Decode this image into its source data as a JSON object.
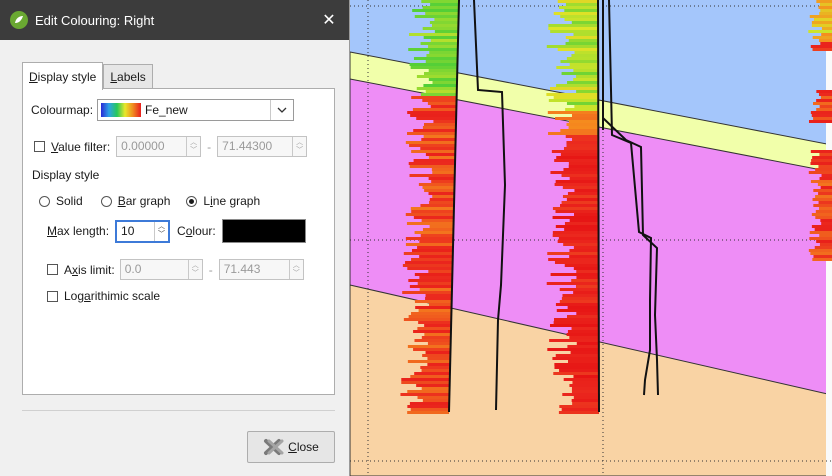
{
  "dialog": {
    "title": "Edit Colouring: Right",
    "close_glyph": "✕",
    "tabs": [
      {
        "label_pre": "",
        "label_key": "D",
        "label_post": "isplay style",
        "active": true
      },
      {
        "label_pre": "",
        "label_key": "L",
        "label_post": "abels",
        "active": false
      }
    ],
    "colourmap": {
      "label": "Colourmap:",
      "selected": "Fe_new",
      "gradient_colors": [
        "#2b2bd6",
        "#2fa3e6",
        "#28c85a",
        "#e8e82c",
        "#f08a20",
        "#e81f1f"
      ]
    },
    "value_filter": {
      "label_key": "V",
      "label_rest": "alue filter:",
      "checked": false,
      "min": "0.00000",
      "dash": "-",
      "max": "71.44300"
    },
    "display_style": {
      "heading": "Display style",
      "options": [
        {
          "label_key": "",
          "label_pre": "",
          "label": "Solid",
          "selected": false
        },
        {
          "label_key": "B",
          "label": "ar graph",
          "selected": false
        },
        {
          "label_key": "i",
          "label_pre": "L",
          "label": "ne graph",
          "selected": true
        }
      ]
    },
    "max_length": {
      "label_key": "M",
      "label_rest": "ax length:",
      "value": "10",
      "colour_label_pre": "C",
      "colour_label_key": "o",
      "colour_label_rest": "lour:",
      "colour_value": "#000000"
    },
    "axis_limit": {
      "label_pre": "A",
      "label_key": "x",
      "label_rest": "is limit:",
      "checked": false,
      "min": "0.0",
      "dash": "-",
      "max": "71.443"
    },
    "log_scale": {
      "label_pre": "Log",
      "label_key": "a",
      "label_rest": "rithimic scale",
      "checked": false
    },
    "close_button": {
      "label_key": "C",
      "label_rest": "lose"
    }
  },
  "scene": {
    "colors": {
      "top_unit": "#a4c6fb",
      "yellow_unit": "#f1ffaa",
      "pink_unit": "#ee8df6",
      "tan_unit": "#f9d3a4",
      "grid": "#333333"
    }
  }
}
